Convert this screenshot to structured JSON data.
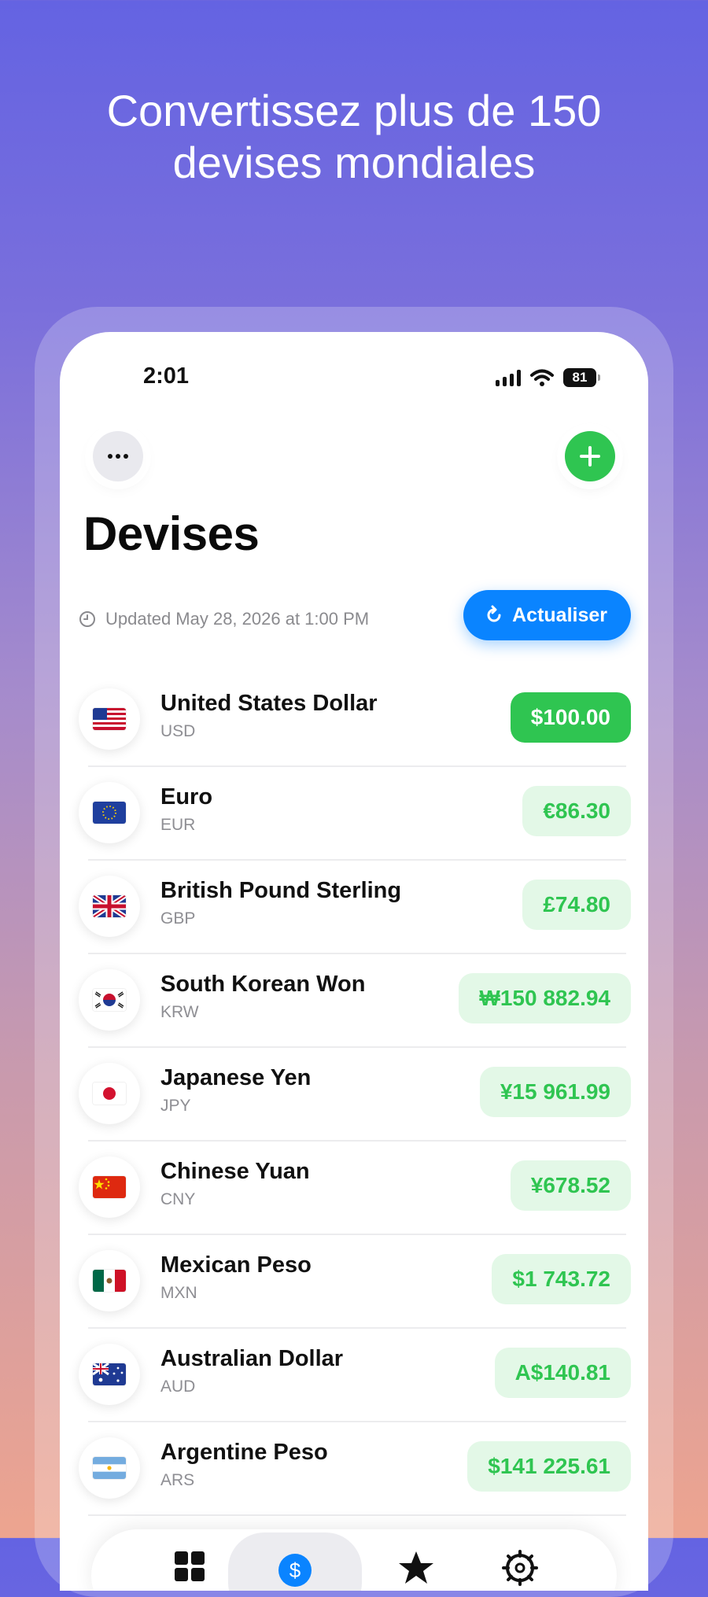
{
  "headline": {
    "line1": "Convertissez plus de 150",
    "line2": "devises mondiales"
  },
  "status_bar": {
    "time": "2:01",
    "battery": "81"
  },
  "toolbar": {
    "more_icon": "ellipsis-icon",
    "add_icon": "plus-icon"
  },
  "page": {
    "title": "Devises",
    "updated": "Updated May 28, 2026 at 1:00 PM",
    "refresh_label": "Actualiser"
  },
  "colors": {
    "green": "#2fc551",
    "green_tint": "#e3f8e7",
    "blue": "#0a84ff"
  },
  "currencies": [
    {
      "name": "United States Dollar",
      "code": "USD",
      "amount": "$100.00",
      "flag": "us-flag-icon",
      "primary": true
    },
    {
      "name": "Euro",
      "code": "EUR",
      "amount": "€86.30",
      "flag": "eu-flag-icon"
    },
    {
      "name": "British Pound Sterling",
      "code": "GBP",
      "amount": "£74.80",
      "flag": "uk-flag-icon"
    },
    {
      "name": "South Korean Won",
      "code": "KRW",
      "amount": "₩150 882.94",
      "flag": "kr-flag-icon"
    },
    {
      "name": "Japanese Yen",
      "code": "JPY",
      "amount": "¥15 961.99",
      "flag": "jp-flag-icon"
    },
    {
      "name": "Chinese Yuan",
      "code": "CNY",
      "amount": "¥678.52",
      "flag": "cn-flag-icon"
    },
    {
      "name": "Mexican Peso",
      "code": "MXN",
      "amount": "$1 743.72",
      "flag": "mx-flag-icon"
    },
    {
      "name": "Australian Dollar",
      "code": "AUD",
      "amount": "A$140.81",
      "flag": "au-flag-icon"
    },
    {
      "name": "Argentine Peso",
      "code": "ARS",
      "amount": "$141 225.61",
      "flag": "ar-flag-icon"
    }
  ],
  "tabbar": {
    "tabs": [
      {
        "icon": "grid-icon"
      },
      {
        "icon": "dollar-icon",
        "active": true
      },
      {
        "icon": "star-icon"
      },
      {
        "icon": "settings-icon"
      }
    ]
  }
}
